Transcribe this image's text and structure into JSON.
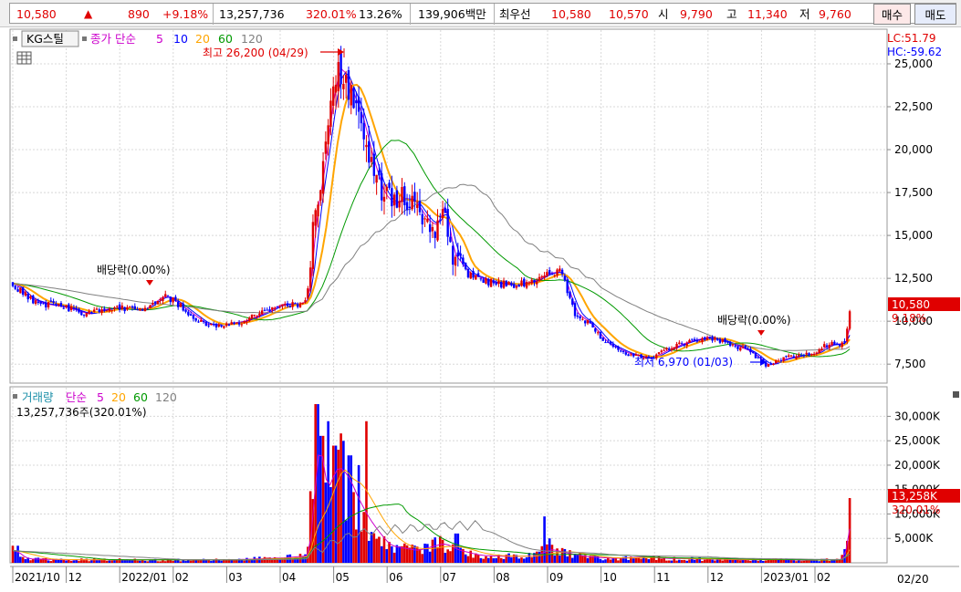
{
  "quote": {
    "price": "10,580",
    "arrow": "▲",
    "change": "890",
    "change_pct": "+9.18%",
    "volume": "13,257,736",
    "volume_ratio": "320.01%",
    "turnover": "13.26%",
    "amount": "139,906백만",
    "best_label": "최우선",
    "best_ask": "10,580",
    "best_bid": "10,570",
    "open_label": "시",
    "open": "9,790",
    "high_label": "고",
    "high": "11,340",
    "low_label": "저",
    "low": "9,760",
    "buy_label": "매수",
    "sell_label": "매도",
    "up_color": "#e00000",
    "down_color": "#0000ff"
  },
  "price_panel": {
    "stock_name": "KG스틸",
    "legend_prefix": "종가 단순",
    "ma_periods": [
      "5",
      "10",
      "20",
      "60",
      "120"
    ],
    "ma_colors": [
      "#cc00cc",
      "#0000ff",
      "#ffa500",
      "#009900",
      "#808080"
    ],
    "lc_label": "LC:51.79",
    "hc_label": "HC:-59.62",
    "high_annotation": "최고 26,200 (04/29)",
    "low_annotation": "최저 6,970 (01/03)",
    "dividend_label_1": "배당락(0.00%)",
    "dividend_label_2": "배당락(0.00%)",
    "current_price_tag": "10,580",
    "current_pct_tag": "9.18%"
  },
  "volume_panel": {
    "title": "거래량",
    "legend_prefix": "단순",
    "ma_periods": [
      "5",
      "20",
      "60",
      "120"
    ],
    "ma_colors": [
      "#cc00cc",
      "#ffa500",
      "#009900",
      "#808080"
    ],
    "value_label": "13,257,736주(320.01%)",
    "current_volume_tag": "13,258K",
    "current_volume_pct_tag": "320.01%"
  },
  "xaxis": {
    "labels": [
      "2021/10",
      "12",
      "2022/01",
      "02",
      "03",
      "04",
      "05",
      "06",
      "07",
      "08",
      "09",
      "10",
      "11",
      "12",
      "2023/01",
      "02"
    ],
    "cursor_label": "02/20"
  },
  "chart_data": [
    {
      "type": "candlestick",
      "title": "KG스틸",
      "y_range": [
        6500,
        26700
      ],
      "y_ticks": [
        7500,
        10000,
        12500,
        15000,
        17500,
        20000,
        22500,
        25000
      ],
      "y_tick_labels": [
        "7,500",
        "10,000",
        "12,500",
        "15,000",
        "17,500",
        "20,000",
        "22,500",
        "25,000"
      ],
      "x_months": [
        "2021/10",
        "12",
        "2022/01",
        "02",
        "03",
        "04",
        "05",
        "06",
        "07",
        "08",
        "09",
        "10",
        "11",
        "12",
        "2023/01",
        "02"
      ],
      "close_path": [
        {
          "m": 0.0,
          "v": 12200
        },
        {
          "m": 0.3,
          "v": 11300
        },
        {
          "m": 0.6,
          "v": 11000
        },
        {
          "m": 1.0,
          "v": 10800
        },
        {
          "m": 1.4,
          "v": 10400
        },
        {
          "m": 1.7,
          "v": 10700
        },
        {
          "m": 2.0,
          "v": 10800
        },
        {
          "m": 2.4,
          "v": 10600
        },
        {
          "m": 2.8,
          "v": 11500
        },
        {
          "m": 3.0,
          "v": 11200
        },
        {
          "m": 3.3,
          "v": 10500
        },
        {
          "m": 3.6,
          "v": 9800
        },
        {
          "m": 3.9,
          "v": 9800
        },
        {
          "m": 4.3,
          "v": 10000
        },
        {
          "m": 4.7,
          "v": 10500
        },
        {
          "m": 5.0,
          "v": 11000
        },
        {
          "m": 5.3,
          "v": 11000
        },
        {
          "m": 5.5,
          "v": 11200
        },
        {
          "m": 5.65,
          "v": 16500
        },
        {
          "m": 5.8,
          "v": 19000
        },
        {
          "m": 5.95,
          "v": 23000
        },
        {
          "m": 6.1,
          "v": 25000
        },
        {
          "m": 6.3,
          "v": 23500
        },
        {
          "m": 6.5,
          "v": 22000
        },
        {
          "m": 6.7,
          "v": 19500
        },
        {
          "m": 6.9,
          "v": 17500
        },
        {
          "m": 7.1,
          "v": 16800
        },
        {
          "m": 7.3,
          "v": 17200
        },
        {
          "m": 7.5,
          "v": 17000
        },
        {
          "m": 7.7,
          "v": 16000
        },
        {
          "m": 7.9,
          "v": 15500
        },
        {
          "m": 8.05,
          "v": 17000
        },
        {
          "m": 8.2,
          "v": 14000
        },
        {
          "m": 8.5,
          "v": 12800
        },
        {
          "m": 8.9,
          "v": 12300
        },
        {
          "m": 9.3,
          "v": 12100
        },
        {
          "m": 9.7,
          "v": 12300
        },
        {
          "m": 10.0,
          "v": 12800
        },
        {
          "m": 10.25,
          "v": 12900
        },
        {
          "m": 10.5,
          "v": 10500
        },
        {
          "m": 10.8,
          "v": 9800
        },
        {
          "m": 11.1,
          "v": 8700
        },
        {
          "m": 11.5,
          "v": 8100
        },
        {
          "m": 11.9,
          "v": 7800
        },
        {
          "m": 12.2,
          "v": 8300
        },
        {
          "m": 12.6,
          "v": 8800
        },
        {
          "m": 13.0,
          "v": 9100
        },
        {
          "m": 13.4,
          "v": 8700
        },
        {
          "m": 13.8,
          "v": 8200
        },
        {
          "m": 14.1,
          "v": 7400
        },
        {
          "m": 14.4,
          "v": 7800
        },
        {
          "m": 14.7,
          "v": 8000
        },
        {
          "m": 15.0,
          "v": 8100
        },
        {
          "m": 15.2,
          "v": 8600
        },
        {
          "m": 15.45,
          "v": 8700
        },
        {
          "m": 15.55,
          "v": 8650
        },
        {
          "m": 15.65,
          "v": 10580
        }
      ],
      "series": [
        {
          "name": "5",
          "color": "#cc00cc",
          "lag": 0.1
        },
        {
          "name": "10",
          "color": "#0000ff",
          "lag": 0.2
        },
        {
          "name": "20",
          "color": "#ffa500",
          "lag": 0.45
        },
        {
          "name": "60",
          "color": "#009900",
          "lag": 1.4
        },
        {
          "name": "120",
          "color": "#808080",
          "lag": 2.8
        }
      ],
      "annotations": [
        {
          "text": "최고 26,200 (04/29)",
          "m": 6.15,
          "v": 26200
        },
        {
          "text": "최저 6,970 (01/03)",
          "m": 14.1,
          "v": 6970
        }
      ]
    },
    {
      "type": "bar",
      "title": "거래량",
      "y_range": [
        0,
        34000
      ],
      "y_ticks": [
        5000,
        10000,
        15000,
        20000,
        25000,
        30000
      ],
      "y_tick_labels": [
        "5,000K",
        "10,000K",
        "15,000K",
        "20,000K",
        "25,000K",
        "30,000K"
      ],
      "volume_path": [
        {
          "m": 0.0,
          "v": 2500
        },
        {
          "m": 0.2,
          "v": 800
        },
        {
          "m": 1.0,
          "v": 600
        },
        {
          "m": 2.0,
          "v": 600
        },
        {
          "m": 3.0,
          "v": 600
        },
        {
          "m": 4.0,
          "v": 600
        },
        {
          "m": 5.0,
          "v": 1000
        },
        {
          "m": 5.5,
          "v": 1500
        },
        {
          "m": 5.65,
          "v": 28000
        },
        {
          "m": 5.8,
          "v": 14000
        },
        {
          "m": 6.0,
          "v": 20000
        },
        {
          "m": 6.2,
          "v": 18000
        },
        {
          "m": 6.4,
          "v": 13000
        },
        {
          "m": 6.6,
          "v": 9000
        },
        {
          "m": 6.8,
          "v": 6000
        },
        {
          "m": 7.0,
          "v": 3500
        },
        {
          "m": 7.5,
          "v": 2500
        },
        {
          "m": 8.0,
          "v": 4000
        },
        {
          "m": 8.3,
          "v": 2500
        },
        {
          "m": 8.7,
          "v": 1500
        },
        {
          "m": 9.2,
          "v": 1300
        },
        {
          "m": 9.7,
          "v": 1400
        },
        {
          "m": 10.0,
          "v": 2800
        },
        {
          "m": 10.3,
          "v": 2000
        },
        {
          "m": 10.7,
          "v": 1200
        },
        {
          "m": 11.2,
          "v": 900
        },
        {
          "m": 11.7,
          "v": 1200
        },
        {
          "m": 12.2,
          "v": 900
        },
        {
          "m": 12.7,
          "v": 800
        },
        {
          "m": 13.2,
          "v": 700
        },
        {
          "m": 13.7,
          "v": 600
        },
        {
          "m": 14.2,
          "v": 700
        },
        {
          "m": 14.7,
          "v": 500
        },
        {
          "m": 15.2,
          "v": 600
        },
        {
          "m": 15.5,
          "v": 700
        },
        {
          "m": 15.65,
          "v": 13258
        }
      ],
      "spikes": [
        {
          "m": 5.68,
          "v": 32500
        },
        {
          "m": 5.78,
          "v": 26000
        },
        {
          "m": 5.9,
          "v": 29000
        },
        {
          "m": 6.02,
          "v": 24000
        },
        {
          "m": 6.15,
          "v": 26500
        },
        {
          "m": 6.3,
          "v": 22000
        },
        {
          "m": 6.48,
          "v": 20000
        },
        {
          "m": 6.6,
          "v": 29000
        },
        {
          "m": 8.0,
          "v": 5500
        },
        {
          "m": 8.3,
          "v": 6000
        },
        {
          "m": 9.95,
          "v": 9500
        },
        {
          "m": 10.05,
          "v": 5000
        },
        {
          "m": 0.08,
          "v": 3500
        },
        {
          "m": 15.6,
          "v": 4500
        },
        {
          "m": 15.66,
          "v": 13258
        }
      ],
      "series": [
        {
          "name": "5",
          "color": "#cc00cc",
          "lag": 0.15
        },
        {
          "name": "20",
          "color": "#ffa500",
          "lag": 0.6
        },
        {
          "name": "60",
          "color": "#009900",
          "lag": 1.6
        },
        {
          "name": "120",
          "color": "#808080",
          "lag": 3.0
        }
      ]
    }
  ]
}
